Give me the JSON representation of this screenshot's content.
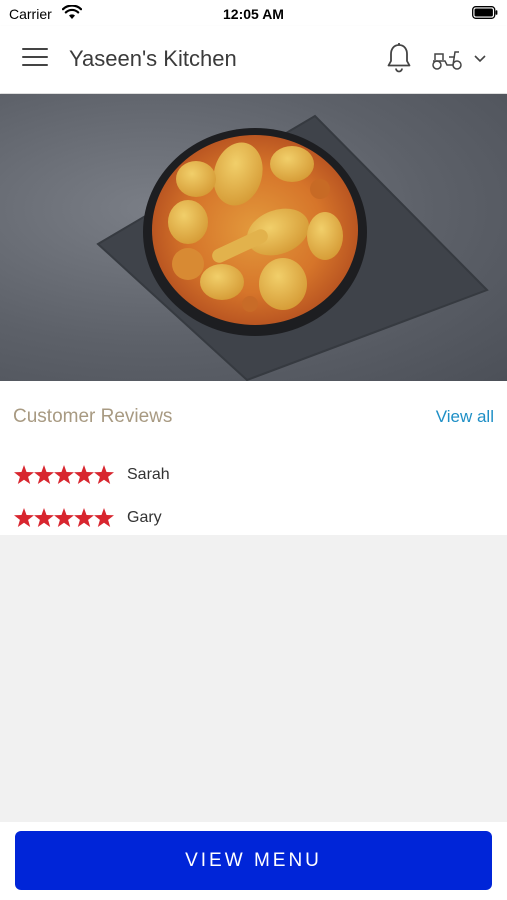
{
  "status_bar": {
    "carrier": "Carrier",
    "time": "12:05 AM"
  },
  "header": {
    "title": "Yaseen's Kitchen",
    "icons": [
      "menu-icon",
      "bell-icon",
      "scooter-icon",
      "chevron-down-icon"
    ]
  },
  "hero": {
    "image": "chicken curry in a bowl on a slate board"
  },
  "reviews": {
    "title": "Customer Reviews",
    "view_all": "View all",
    "items": [
      {
        "name": "Sarah",
        "rating": 5,
        "max_rating": 5
      },
      {
        "name": "Gary",
        "rating": 5,
        "max_rating": 5
      }
    ]
  },
  "footer": {
    "button_label": "VIEW MENU"
  },
  "colors": {
    "primary_button": "#0025d8",
    "star": "#d8262f",
    "link": "#1e8fc6",
    "section_title": "#a89a82",
    "background": "#f1f1f1"
  }
}
